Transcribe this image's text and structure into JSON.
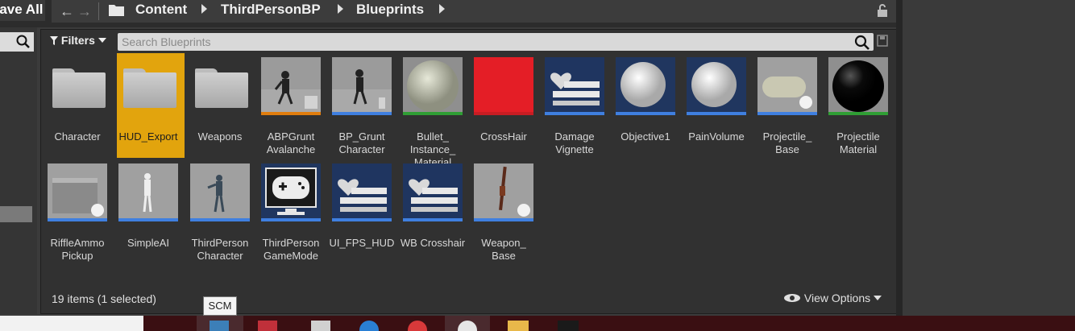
{
  "toolbar": {
    "save_all_label": "Save All"
  },
  "breadcrumb": {
    "back_glyph": "←",
    "forward_glyph": "→",
    "items": [
      "Content",
      "ThirdPersonBP",
      "Blueprints"
    ]
  },
  "filters": {
    "label": "Filters"
  },
  "search": {
    "placeholder": "Search Blueprints"
  },
  "assets": [
    {
      "label": "Character",
      "kind": "folder"
    },
    {
      "label": "HUD_Export",
      "kind": "folder",
      "selected": true
    },
    {
      "label": "Weapons",
      "kind": "folder"
    },
    {
      "label": "ABPGrunt Avalanche",
      "kind": "anim-blueprint",
      "bar_color": "#e07d0e"
    },
    {
      "label": "BP_Grunt Character",
      "kind": "blueprint",
      "bar_color": "#3f7fe0"
    },
    {
      "label": "Bullet_ Instance_ Material",
      "kind": "material-instance",
      "bar_color": "#2f9e34"
    },
    {
      "label": "CrossHair",
      "kind": "texture",
      "bar_color": "#c81d23"
    },
    {
      "label": "Damage Vignette",
      "kind": "widget",
      "bar_color": "#3f7fe0"
    },
    {
      "label": "Objective1",
      "kind": "blueprint",
      "bar_color": "#3f7fe0"
    },
    {
      "label": "PainVolume",
      "kind": "blueprint",
      "bar_color": "#3f7fe0"
    },
    {
      "label": "Projectile_ Base",
      "kind": "blueprint",
      "bar_color": "#3f7fe0"
    },
    {
      "label": "Projectile Material",
      "kind": "material",
      "bar_color": "#2f9e34"
    },
    {
      "label": "RiffleAmmo Pickup",
      "kind": "blueprint",
      "bar_color": "#3f7fe0"
    },
    {
      "label": "SimpleAI",
      "kind": "blueprint",
      "bar_color": "#3f7fe0"
    },
    {
      "label": "ThirdPerson Character",
      "kind": "blueprint",
      "bar_color": "#3f7fe0"
    },
    {
      "label": "ThirdPerson GameMode",
      "kind": "gamemode",
      "bar_color": "#3f7fe0"
    },
    {
      "label": "UI_FPS_HUD",
      "kind": "widget",
      "bar_color": "#3f7fe0"
    },
    {
      "label": "WB Crosshair",
      "kind": "widget",
      "bar_color": "#3f7fe0"
    },
    {
      "label": "Weapon_ Base",
      "kind": "blueprint",
      "bar_color": "#3f7fe0"
    }
  ],
  "status": {
    "items_count": "19 items (1 selected)"
  },
  "view_options": {
    "label": "View Options"
  },
  "tooltip": {
    "text": "SCM"
  },
  "colors": {
    "accent_selected": "#e2a40d",
    "panel_bg": "#313131"
  }
}
